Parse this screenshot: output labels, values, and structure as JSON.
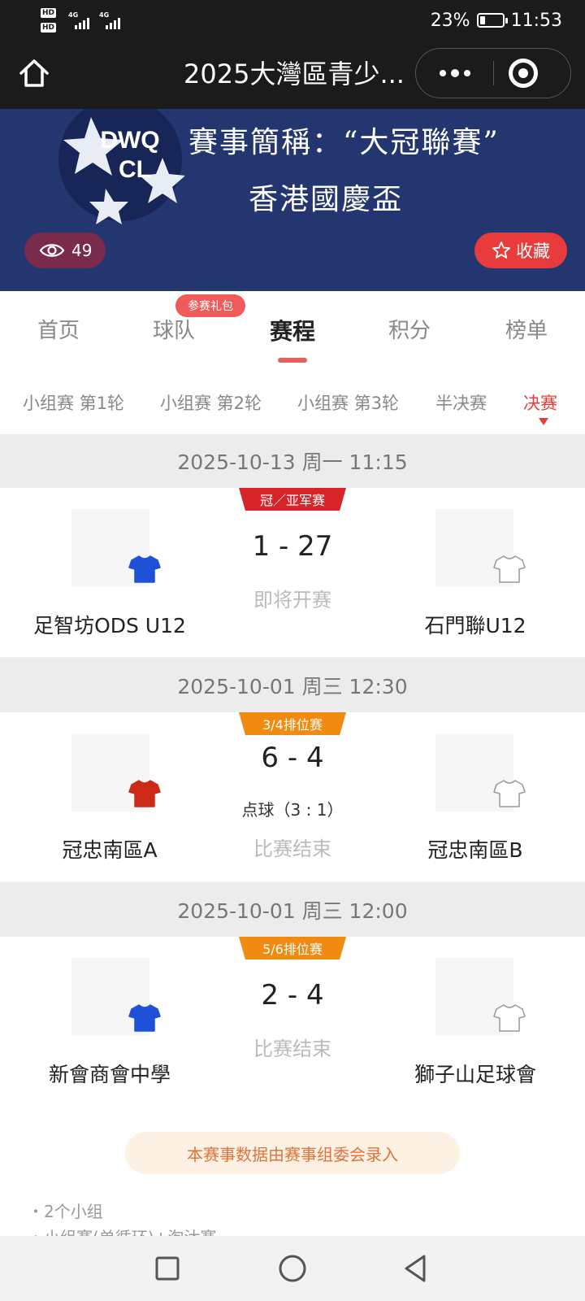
{
  "status_bar": {
    "network_left": "HD",
    "network_left_sub": "1",
    "network_left2": "HD",
    "network_left2_sub": "2",
    "signal1_type": "4G",
    "signal2_type": "4G",
    "battery_percent": "23%",
    "battery_level": 0.23,
    "time": "11:53"
  },
  "title_bar": {
    "title": "2025大灣區青少...",
    "icons": [
      "home-icon",
      "more-icon",
      "close-target-icon"
    ]
  },
  "banner": {
    "logo_text_line1": "DWQ",
    "logo_text_line2": "CL",
    "line1": "賽事簡稱：“大冠聯賽”",
    "line2": "香港國慶盃",
    "views": "49",
    "favorite_label": "收藏",
    "colors": {
      "background": "#24366f",
      "favorite": "#e83b3b"
    }
  },
  "tabs": {
    "items": [
      {
        "label": "首页",
        "active": false
      },
      {
        "label": "球队",
        "active": false
      },
      {
        "label": "赛程",
        "active": true
      },
      {
        "label": "积分",
        "active": false
      },
      {
        "label": "榜单",
        "active": false
      }
    ],
    "badge": "参赛礼包"
  },
  "rounds": {
    "items": [
      {
        "label": "小组赛 第1轮"
      },
      {
        "label": "小组赛 第2轮"
      },
      {
        "label": "小组赛 第3轮"
      },
      {
        "label": "半决赛"
      },
      {
        "label": "决赛",
        "active": true
      }
    ]
  },
  "matches": [
    {
      "datetime": "2025-10-13 周一 11:15",
      "stage": "冠／亚军赛",
      "stage_color": "#d6242a",
      "home": {
        "name": "足智坊ODS U12",
        "jersey_color": "#1e50d8"
      },
      "away": {
        "name": "石門聯U12",
        "jersey_color": "#ffffff"
      },
      "score": "1 - 27",
      "penalties": "",
      "status": "即将开赛"
    },
    {
      "datetime": "2025-10-01 周三 12:30",
      "stage": "3/4排位赛",
      "stage_color": "#f08a10",
      "home": {
        "name": "冠忠南區A",
        "jersey_color": "#cc2a18"
      },
      "away": {
        "name": "冠忠南區B",
        "jersey_color": "#ffffff"
      },
      "score": "6 - 4",
      "penalties": "点球（3 : 1）",
      "status": "比赛结束"
    },
    {
      "datetime": "2025-10-01 周三 12:00",
      "stage": "5/6排位赛",
      "stage_color": "#f08a10",
      "home": {
        "name": "新會商會中學",
        "jersey_color": "#1e50d8"
      },
      "away": {
        "name": "獅子山足球會",
        "jersey_color": "#ffffff"
      },
      "score": "2 - 4",
      "penalties": "",
      "status": "比赛结束"
    }
  ],
  "footer": {
    "notice": "本赛事数据由赛事组委会录入",
    "notes": [
      "・2个小组",
      "・小组赛(单循环)+淘汰赛"
    ]
  },
  "nav_bar": {
    "icons": [
      "recent-apps-icon",
      "home-circle-icon",
      "back-icon"
    ]
  }
}
